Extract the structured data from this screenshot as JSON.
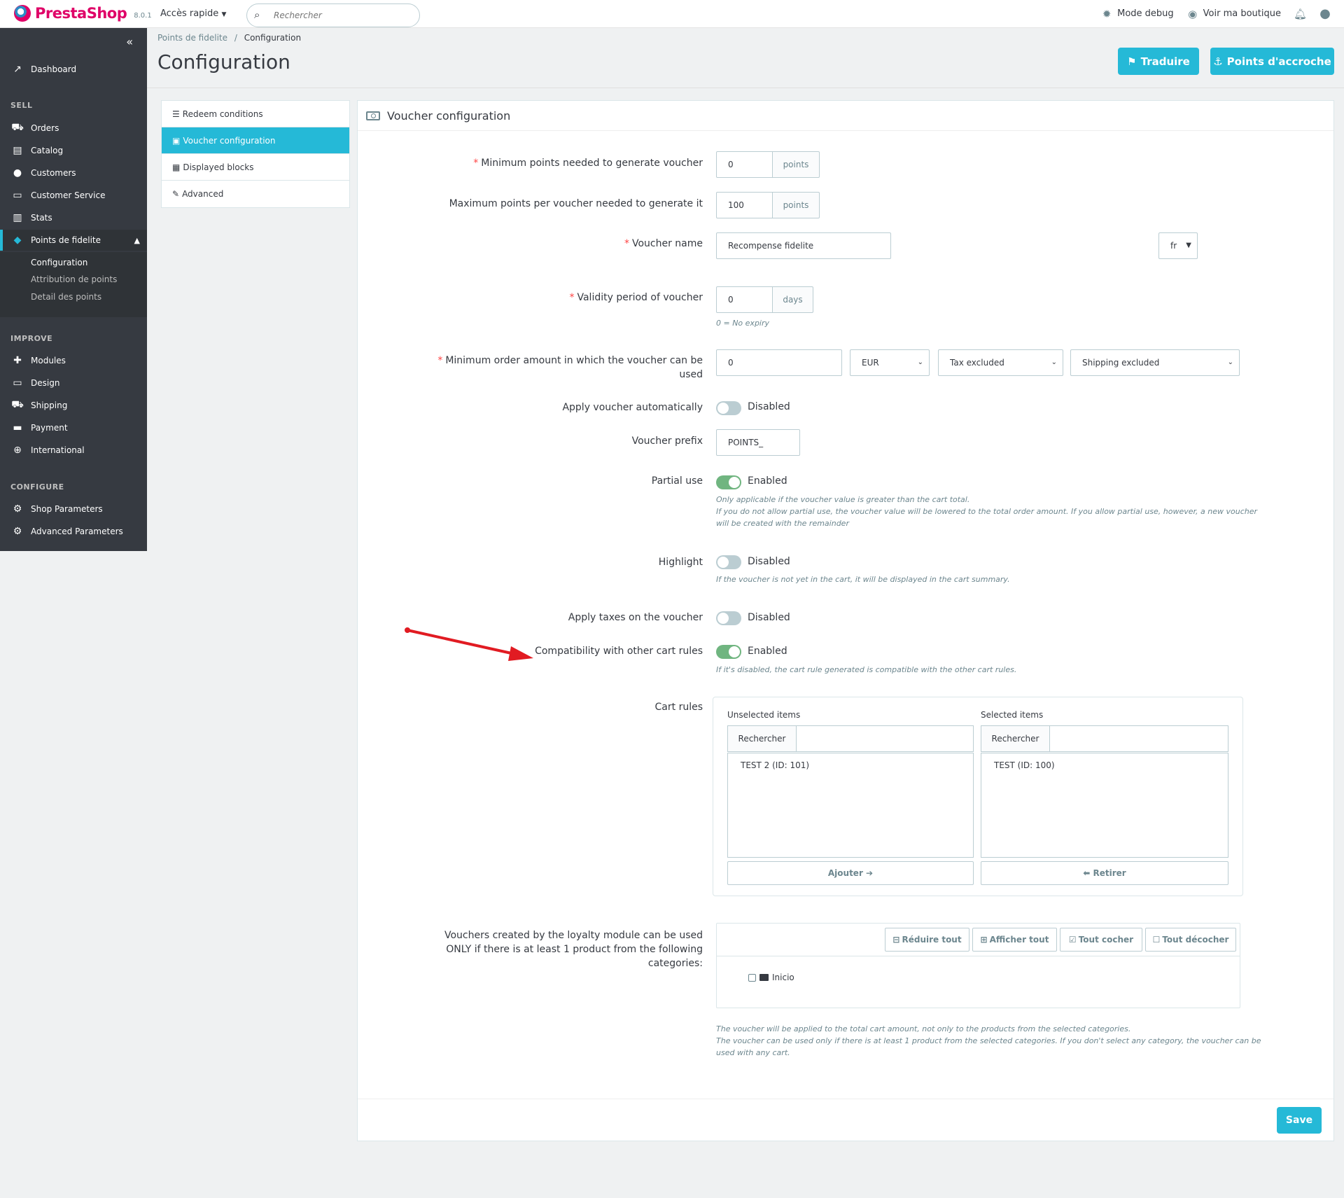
{
  "header": {
    "logo": "PrestaShop",
    "version": "8.0.1",
    "quick_access": "Accès rapide",
    "search_placeholder": "Rechercher",
    "debug": "Mode debug",
    "view_shop": "Voir ma boutique"
  },
  "sidebar": {
    "dashboard": "Dashboard",
    "sections": {
      "sell": "SELL",
      "improve": "IMPROVE",
      "configure": "CONFIGURE"
    },
    "sell_items": [
      "Orders",
      "Catalog",
      "Customers",
      "Customer Service",
      "Stats",
      "Points de fidelite"
    ],
    "submenu": [
      "Configuration",
      "Attribution de points",
      "Detail des points"
    ],
    "improve_items": [
      "Modules",
      "Design",
      "Shipping",
      "Payment",
      "International"
    ],
    "configure_items": [
      "Shop Parameters",
      "Advanced Parameters"
    ]
  },
  "breadcrumb": {
    "parent": "Points de fidelite",
    "separator": "/",
    "current": "Configuration"
  },
  "page_title": "Configuration",
  "toolbar": {
    "translate": "Traduire",
    "hooks": "Points d'accroche"
  },
  "tabs": [
    "Redeem conditions",
    "Voucher configuration",
    "Displayed blocks",
    "Advanced"
  ],
  "panel": {
    "title": "Voucher configuration",
    "min_points": {
      "label": "Minimum points needed to generate voucher",
      "value": "0",
      "unit": "points"
    },
    "max_points": {
      "label": "Maximum points per voucher needed to generate it",
      "value": "100",
      "unit": "points"
    },
    "voucher_name": {
      "label": "Voucher name",
      "value": "Recompense fidelite",
      "lang": "fr"
    },
    "validity": {
      "label": "Validity period of voucher",
      "value": "0",
      "unit": "days",
      "help": "0 = No expiry"
    },
    "min_order": {
      "label": "Minimum order amount in which the voucher can be used",
      "value": "0",
      "currency": "EUR",
      "tax": "Tax excluded",
      "shipping": "Shipping excluded"
    },
    "apply_auto": {
      "label": "Apply voucher automatically",
      "state": "Disabled"
    },
    "prefix": {
      "label": "Voucher prefix",
      "value": "POINTS_"
    },
    "partial_use": {
      "label": "Partial use",
      "state": "Enabled",
      "help1": "Only applicable if the voucher value is greater than the cart total.",
      "help2": "If you do not allow partial use, the voucher value will be lowered to the total order amount. If you allow partial use, however, a new voucher",
      "help3": "will be created with the remainder"
    },
    "highlight": {
      "label": "Highlight",
      "state": "Disabled",
      "help": "If the voucher is not yet in the cart, it will be displayed in the cart summary."
    },
    "apply_taxes": {
      "label": "Apply taxes on the voucher",
      "state": "Disabled"
    },
    "compatibility": {
      "label": "Compatibility with other cart rules",
      "state": "Enabled",
      "help": "If it's disabled, the cart rule generated is compatible with the other cart rules."
    },
    "cart_rules": {
      "label": "Cart rules",
      "unselected_title": "Unselected items",
      "selected_title": "Selected items",
      "search_label": "Rechercher",
      "unselected": [
        "TEST 2 (ID: 101)"
      ],
      "selected": [
        "TEST (ID: 100)"
      ],
      "add": "Ajouter",
      "remove": "Retirer"
    },
    "categories": {
      "label1": "Vouchers created by the loyalty module can be used",
      "label2": "ONLY if there is at least 1 product from the following",
      "label3": "categories:",
      "collapse": "Réduire tout",
      "expand": "Afficher tout",
      "check_all": "Tout cocher",
      "uncheck_all": "Tout décocher",
      "root": "Inicio",
      "help1": "The voucher will be applied to the total cart amount, not only to the products from the selected categories.",
      "help2": "The voucher can be used only if there is at least 1 product from the selected categories. If you don't select any category, the voucher can be",
      "help3": "used with any cart."
    },
    "save": "Save"
  },
  "colors": {
    "accent": "#25b9d7",
    "sidebar": "#363a41",
    "enabled": "#70b580",
    "required": "#ff4444",
    "annotation_arrow": "#e11b22"
  }
}
